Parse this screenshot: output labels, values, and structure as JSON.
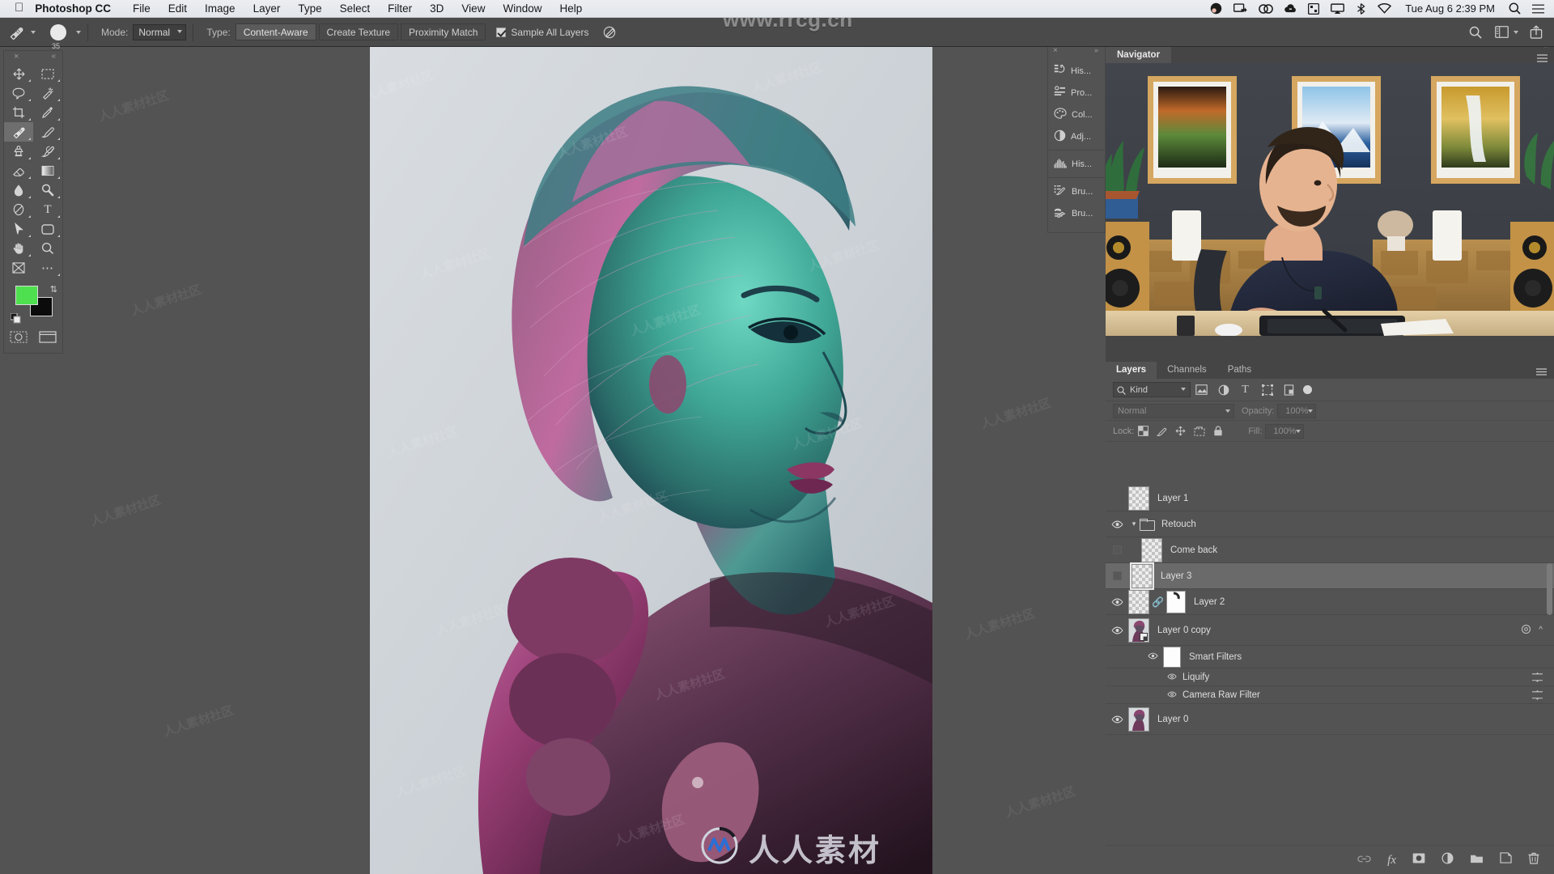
{
  "macbar": {
    "app_name": "Photoshop CC",
    "menus": [
      "File",
      "Edit",
      "Image",
      "Layer",
      "Type",
      "Select",
      "Filter",
      "3D",
      "View",
      "Window",
      "Help"
    ],
    "status_icons": [
      "user-avatar-icon",
      "screen-share-icon",
      "creative-cloud-icon",
      "dropbox-icon",
      "grid-icon",
      "airplay-icon",
      "bluetooth-icon",
      "wifi-icon"
    ],
    "clock": "Tue Aug 6  2:39 PM",
    "right_icons": [
      "spotlight-search-icon",
      "control-center-icon"
    ]
  },
  "options_bar": {
    "tool_icon": "spot-healing-brush-icon",
    "brush_size": "35",
    "mode_label": "Mode:",
    "mode_value": "Normal",
    "type_label": "Type:",
    "type_options": [
      "Content-Aware",
      "Create Texture",
      "Proximity Match"
    ],
    "type_selected": "Content-Aware",
    "sample_all_layers": "Sample All Layers",
    "sample_all_layers_checked": true,
    "pressure_icon": "tablet-pressure-icon",
    "right_icons": [
      "search-icon",
      "workspace-switcher-icon",
      "share-icon"
    ]
  },
  "toolbar": {
    "close_label": "×",
    "collapse_label": "«",
    "tools": [
      {
        "name": "move-tool",
        "glyph": "✥"
      },
      {
        "name": "rectangular-marquee-tool",
        "glyph": "⬚"
      },
      {
        "name": "lasso-tool",
        "glyph": "⟲"
      },
      {
        "name": "magic-wand-tool",
        "glyph": "✦"
      },
      {
        "name": "crop-tool",
        "glyph": "⌙"
      },
      {
        "name": "eyedropper-tool",
        "glyph": "✐"
      },
      {
        "name": "spot-healing-brush-tool",
        "glyph": "✐"
      },
      {
        "name": "brush-tool",
        "glyph": "✎"
      },
      {
        "name": "clone-stamp-tool",
        "glyph": "♟"
      },
      {
        "name": "history-brush-tool",
        "glyph": "✐"
      },
      {
        "name": "eraser-tool",
        "glyph": "◢"
      },
      {
        "name": "gradient-tool",
        "glyph": "■"
      },
      {
        "name": "blur-tool",
        "glyph": "●"
      },
      {
        "name": "dodge-tool",
        "glyph": "♀"
      },
      {
        "name": "pen-tool",
        "glyph": "✒"
      },
      {
        "name": "type-tool",
        "glyph": "T"
      },
      {
        "name": "path-selection-tool",
        "glyph": "➤"
      },
      {
        "name": "rounded-rectangle-tool",
        "glyph": "▢"
      },
      {
        "name": "hand-tool",
        "glyph": "✋"
      },
      {
        "name": "zoom-tool",
        "glyph": "⚲"
      },
      {
        "name": "edit-toolbar-tool",
        "glyph": "⌧"
      },
      {
        "name": "more-tools",
        "glyph": "⋯"
      }
    ],
    "selected_tool": "spot-healing-brush-tool",
    "foreground_color": "#4fe04f",
    "background_color": "#0b0b0b",
    "swap_icon": "swap-colors-icon",
    "default_icon": "default-colors-icon",
    "quickmask_icon": "quick-mask-icon",
    "screenmode_icon": "screen-mode-icon"
  },
  "dock": {
    "close_label": "×",
    "expand_label": "»",
    "groups": [
      [
        {
          "label": "His...",
          "icon": "history-icon"
        },
        {
          "label": "Pro...",
          "icon": "properties-icon"
        },
        {
          "label": "Col...",
          "icon": "color-icon"
        },
        {
          "label": "Adj...",
          "icon": "adjustments-icon"
        }
      ],
      [
        {
          "label": "His...",
          "icon": "histogram-icon"
        }
      ],
      [
        {
          "label": "Bru...",
          "icon": "brush-presets-icon"
        },
        {
          "label": "Bru...",
          "icon": "brush-settings-icon"
        }
      ]
    ]
  },
  "navigator": {
    "tab_label": "Navigator",
    "menu_icon": "panel-menu-icon",
    "collapse_icon": "collapse-panel-icon",
    "content_description": "video-preview-of-instructor-at-desk"
  },
  "layers_panel": {
    "tabs": [
      "Layers",
      "Channels",
      "Paths"
    ],
    "active_tab": "Layers",
    "menu_icon": "panel-menu-icon",
    "filter": {
      "kind_label": "Kind",
      "search_icon": "search-icon",
      "filter_icons": [
        "pixel-layer-filter-icon",
        "adjustment-layer-filter-icon",
        "type-layer-filter-icon",
        "shape-layer-filter-icon",
        "smart-object-filter-icon"
      ],
      "toggle_icon": "filter-toggle-icon"
    },
    "blend": {
      "mode": "Normal",
      "opacity_label": "Opacity:",
      "opacity_value": "100%"
    },
    "lock": {
      "label": "Lock:",
      "icons": [
        "lock-transparent-pixels-icon",
        "lock-image-pixels-icon",
        "lock-position-icon",
        "lock-artboard-nesting-icon",
        "lock-all-icon"
      ],
      "fill_label": "Fill:",
      "fill_value": "100%"
    },
    "layers": [
      {
        "name": "Layer 1",
        "visible": false,
        "indent": 0,
        "type": "pixel",
        "thumb": "checker",
        "selected": false
      },
      {
        "name": "Retouch",
        "visible": true,
        "indent": 0,
        "type": "group",
        "expanded": true,
        "selected": false
      },
      {
        "name": "Come back",
        "visible": false,
        "indent": 1,
        "type": "pixel",
        "thumb": "checker",
        "selected": false
      },
      {
        "name": "Layer 3",
        "visible": false,
        "indent": 1,
        "type": "pixel",
        "thumb": "checker",
        "selected": true
      },
      {
        "name": "Layer 2",
        "visible": true,
        "indent": 1,
        "type": "pixel-mask",
        "thumb": "checker",
        "selected": false
      },
      {
        "name": "Layer 0 copy",
        "visible": true,
        "indent": 0,
        "type": "smart-object",
        "thumb": "portrait",
        "selected": false,
        "has_smart_filters": true
      },
      {
        "name": "Smart Filters",
        "visible": true,
        "indent": 2,
        "type": "smart-filters-header",
        "thumb": "white-mask",
        "selected": false
      },
      {
        "name": "Liquify",
        "visible": true,
        "indent": 3,
        "type": "filter",
        "selected": false
      },
      {
        "name": "Camera Raw Filter",
        "visible": true,
        "indent": 3,
        "type": "filter",
        "selected": false
      },
      {
        "name": "Layer 0",
        "visible": true,
        "indent": 0,
        "type": "pixel",
        "thumb": "portrait",
        "selected": false
      }
    ],
    "footer_icons": [
      "link-layers-icon",
      "add-layer-style-icon",
      "add-layer-mask-icon",
      "new-adjustment-layer-icon",
      "new-group-icon",
      "new-layer-icon",
      "delete-layer-icon"
    ]
  },
  "watermarks": {
    "top": "www.rrcg.cn",
    "bottom_text": "人人素材",
    "bottom_logo": "rrcg-logo-icon",
    "tile_text": "人人素材社区"
  },
  "canvas": {
    "document_description": "portrait-of-woman-with-teal-and-magenta-duotone-lighting",
    "cursor_icon": "no-entry-cursor-icon"
  },
  "colors": {
    "accent_green": "#4fe04f",
    "panel_bg": "#535353",
    "panel_dark": "#454545",
    "menubar_bg": "#eceef1"
  }
}
